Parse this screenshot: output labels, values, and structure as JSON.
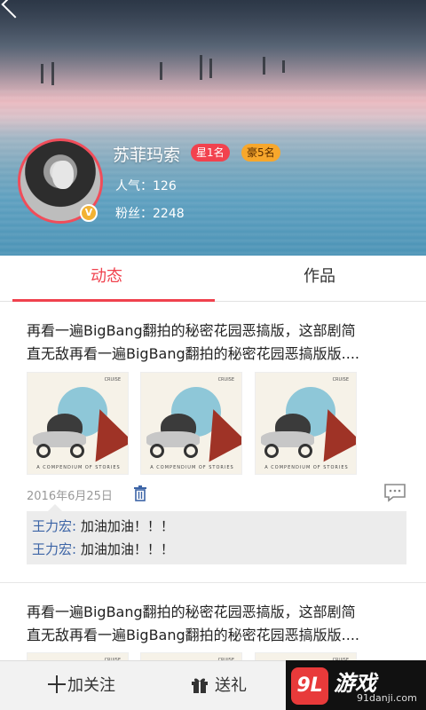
{
  "profile": {
    "name": "苏菲玛索",
    "badge_star": "星1名",
    "badge_rich": "豪5名",
    "popularity": "人气：126",
    "fans": "粉丝：2248",
    "vip_mark": "V"
  },
  "tabs": [
    {
      "label": "动态",
      "active": true
    },
    {
      "label": "作品",
      "active": false
    }
  ],
  "posts": [
    {
      "text_line1": "再看一遍BigBang翻拍的秘密花园恶搞版，这部剧简",
      "text_line2": "直无敌再看一遍BigBang翻拍的秘密花园恶搞版版....",
      "image_top": "CRUISE",
      "image_caption": "A COMPENDIUM OF STORIES",
      "date": "2016年6月25日",
      "comments": [
        {
          "user": "王力宏:",
          "text": "加油加油！！！"
        },
        {
          "user": "王力宏:",
          "text": "加油加油！！！"
        }
      ]
    },
    {
      "text_line1": "再看一遍BigBang翻拍的秘密花园恶搞版，这部剧简",
      "text_line2": "直无敌再看一遍BigBang翻拍的秘密花园恶搞版版....",
      "image_top": "CRUISE"
    }
  ],
  "bottom_bar": {
    "follow_label": "加关注",
    "gift_label": "送礼"
  },
  "watermark": {
    "brand": "游戏",
    "mark": "9L",
    "site": "91danji.com"
  },
  "colors": {
    "accent": "#f0424e",
    "badge_rich": "#f7a72c",
    "comment_user": "#3c64a6"
  }
}
